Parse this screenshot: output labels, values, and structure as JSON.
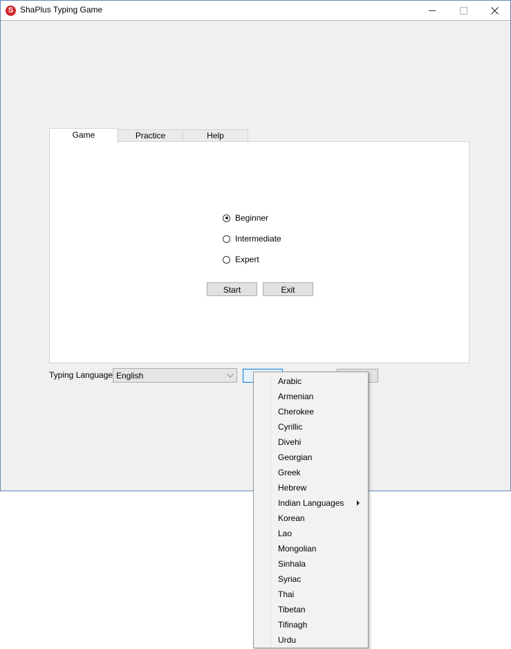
{
  "window": {
    "title": "ShaPlus Typing Game",
    "icon_letter": "S"
  },
  "tabs": [
    {
      "label": "Game",
      "active": true
    },
    {
      "label": "Practice",
      "active": false
    },
    {
      "label": "Help",
      "active": false
    }
  ],
  "difficulty": {
    "options": [
      {
        "label": "Beginner",
        "checked": true
      },
      {
        "label": "Intermediate",
        "checked": false
      },
      {
        "label": "Expert",
        "checked": false
      }
    ]
  },
  "buttons": {
    "start": "Start",
    "exit": "Exit"
  },
  "language": {
    "label": "Typing Language",
    "selected": "English"
  },
  "language_menu": {
    "items": [
      {
        "label": "Arabic"
      },
      {
        "label": "Armenian"
      },
      {
        "label": "Cherokee"
      },
      {
        "label": "Cyrillic"
      },
      {
        "label": "Divehi"
      },
      {
        "label": "Georgian"
      },
      {
        "label": "Greek"
      },
      {
        "label": "Hebrew"
      },
      {
        "label": "Indian Languages",
        "submenu": true
      },
      {
        "label": "Korean"
      },
      {
        "label": "Lao"
      },
      {
        "label": "Mongolian"
      },
      {
        "label": "Sinhala"
      },
      {
        "label": "Syriac"
      },
      {
        "label": "Thai"
      },
      {
        "label": "Tibetan"
      },
      {
        "label": "Tifinagh"
      },
      {
        "label": "Urdu"
      }
    ]
  },
  "colors": {
    "window_border": "#5f88b6",
    "app_icon": "#d3262c",
    "focus_border": "#0078d7"
  }
}
